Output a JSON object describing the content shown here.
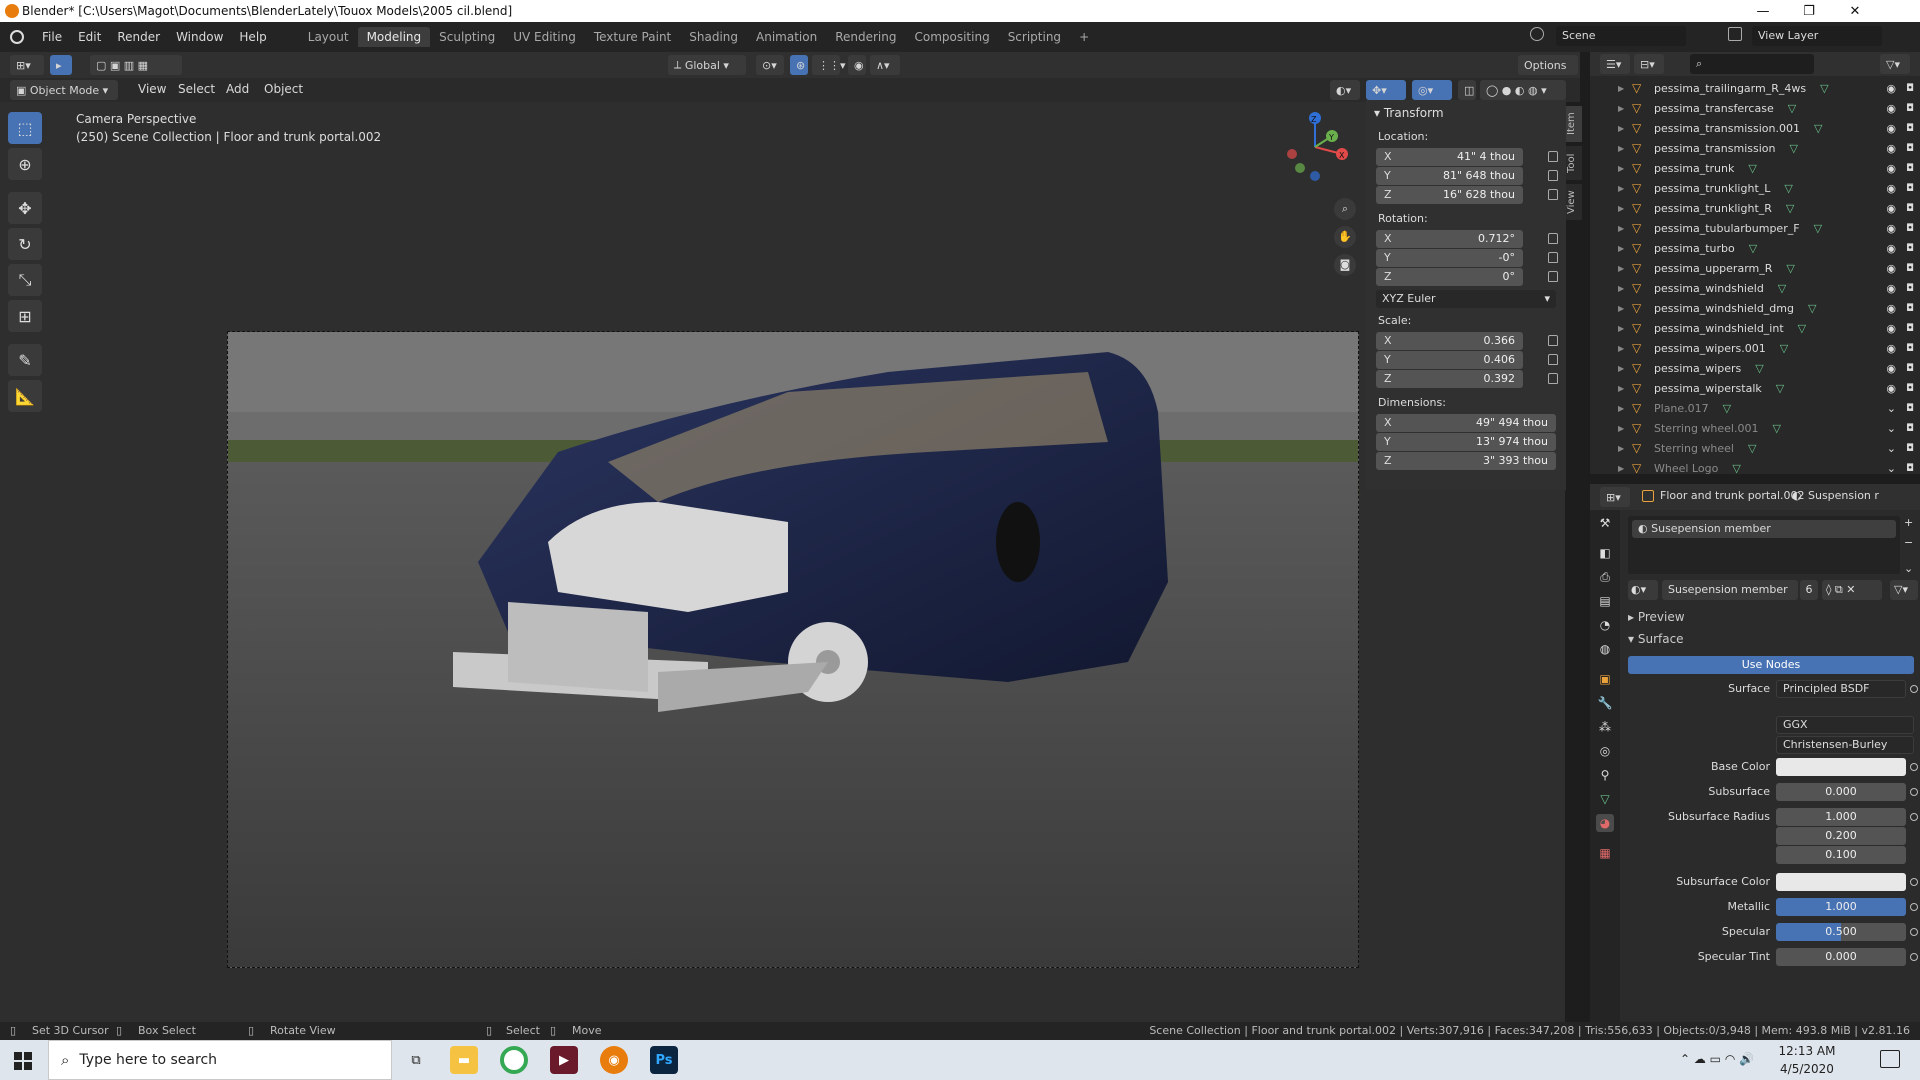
{
  "window": {
    "title": "Blender* [C:\\Users\\Magot\\Documents\\BlenderLately\\Touox Models\\2005 cil.blend]",
    "minimize": "—",
    "maximize": "❐",
    "close": "✕"
  },
  "menu": [
    "File",
    "Edit",
    "Render",
    "Window",
    "Help"
  ],
  "workspaces": [
    "Layout",
    "Modeling",
    "Sculpting",
    "UV Editing",
    "Texture Paint",
    "Shading",
    "Animation",
    "Rendering",
    "Compositing",
    "Scripting"
  ],
  "active_workspace": "Modeling",
  "top_right": {
    "scene": "Scene",
    "view_layer": "View Layer"
  },
  "view_header": {
    "transform_orientation": "Global",
    "options": "Options",
    "mode": "Object Mode",
    "menus": [
      "View",
      "Select",
      "Add",
      "Object"
    ]
  },
  "viewport": {
    "perspective": "Camera Perspective",
    "collection_info": "(250) Scene Collection | Floor and trunk portal.002",
    "gizmo": {
      "x": "X",
      "y": "Y",
      "z": "Z"
    }
  },
  "npanel": {
    "title": "Transform",
    "location_label": "Location:",
    "location": [
      {
        "axis": "X",
        "value": "41\" 4 thou"
      },
      {
        "axis": "Y",
        "value": "81\" 648 thou"
      },
      {
        "axis": "Z",
        "value": "16\" 628 thou"
      }
    ],
    "rotation_label": "Rotation:",
    "rotation": [
      {
        "axis": "X",
        "value": "0.712°"
      },
      {
        "axis": "Y",
        "value": "-0°"
      },
      {
        "axis": "Z",
        "value": "0°"
      }
    ],
    "rotation_mode": "XYZ Euler",
    "scale_label": "Scale:",
    "scale": [
      {
        "axis": "X",
        "value": "0.366"
      },
      {
        "axis": "Y",
        "value": "0.406"
      },
      {
        "axis": "Z",
        "value": "0.392"
      }
    ],
    "dimensions_label": "Dimensions:",
    "dimensions": [
      {
        "axis": "X",
        "value": "49\" 494 thou"
      },
      {
        "axis": "Y",
        "value": "13\" 974 thou"
      },
      {
        "axis": "Z",
        "value": "3\" 393 thou"
      }
    ],
    "tabs": [
      "Item",
      "Tool",
      "View"
    ]
  },
  "outliner": {
    "items": [
      {
        "name": "pessima_trailingarm_R_4ws",
        "dim": false
      },
      {
        "name": "pessima_transfercase",
        "dim": false
      },
      {
        "name": "pessima_transmission.001",
        "dim": false
      },
      {
        "name": "pessima_transmission",
        "dim": false
      },
      {
        "name": "pessima_trunk",
        "dim": false
      },
      {
        "name": "pessima_trunklight_L",
        "dim": false
      },
      {
        "name": "pessima_trunklight_R",
        "dim": false
      },
      {
        "name": "pessima_tubularbumper_F",
        "dim": false
      },
      {
        "name": "pessima_turbo",
        "dim": false
      },
      {
        "name": "pessima_upperarm_R",
        "dim": false
      },
      {
        "name": "pessima_windshield",
        "dim": false
      },
      {
        "name": "pessima_windshield_dmg",
        "dim": false
      },
      {
        "name": "pessima_windshield_int",
        "dim": false
      },
      {
        "name": "pessima_wipers.001",
        "dim": false
      },
      {
        "name": "pessima_wipers",
        "dim": false
      },
      {
        "name": "pessima_wiperstalk",
        "dim": false
      },
      {
        "name": "Plane.017",
        "dim": true
      },
      {
        "name": "Sterring wheel.001",
        "dim": true
      },
      {
        "name": "Sterring wheel",
        "dim": true
      },
      {
        "name": "Wheel Logo",
        "dim": true
      }
    ]
  },
  "properties": {
    "object_name": "Floor and trunk portal.002",
    "material_tab": "Suspension r",
    "slot_name": "Susepension member",
    "material_name": "Susepension member",
    "users": "6",
    "preview": "Preview",
    "surface_section": "Surface",
    "use_nodes": "Use Nodes",
    "surface_label": "Surface",
    "surface_value": "Principled BSDF",
    "distribution": "GGX",
    "subsurface_method": "Christensen-Burley",
    "base_color_label": "Base Color",
    "subsurface_label": "Subsurface",
    "subsurface_value": "0.000",
    "subsurface_radius_label": "Subsurface Radius",
    "subsurface_radius": [
      "1.000",
      "0.200",
      "0.100"
    ],
    "subsurface_color_label": "Subsurface Color",
    "metallic_label": "Metallic",
    "metallic_value": "1.000",
    "specular_label": "Specular",
    "specular_value": "0.500",
    "specular_tint_label": "Specular Tint",
    "specular_tint_value": "0.000"
  },
  "status": {
    "left": [
      "Set 3D Cursor",
      "Box Select",
      "Rotate View",
      "Select",
      "Move"
    ],
    "right": "Scene Collection | Floor and trunk portal.002 | Verts:307,916 | Faces:347,208 | Tris:556,633 | Objects:0/3,948 | Mem: 493.8 MiB | v2.81.16"
  },
  "taskbar": {
    "search_placeholder": "Type here to search",
    "time": "12:13 AM",
    "date": "4/5/2020"
  },
  "colors": {
    "accent": "#4772b3",
    "object_orange": "#e8a13b",
    "mesh_green": "#6ac18a"
  }
}
